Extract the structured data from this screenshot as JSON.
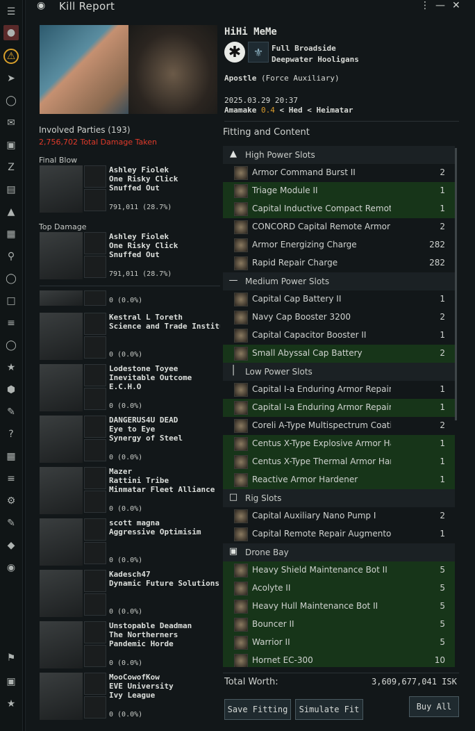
{
  "window": {
    "title": "Kill Report"
  },
  "sidebar": {
    "icons": [
      "menu-icon",
      "character-portrait-icon",
      "alert-icon",
      "ship-icon",
      "inventory-icon",
      "mail-icon",
      "cube-icon",
      "z-icon",
      "chart-icon",
      "map-icon",
      "fitting-icon",
      "search-icon",
      "people-icon",
      "chat-icon",
      "layers-icon",
      "globe-icon",
      "star-icon",
      "shield-icon",
      "wrench-icon",
      "help-icon",
      "list-icon",
      "list2-icon",
      "settings-icon",
      "edit-icon",
      "diamond-icon",
      "kill-icon",
      "flag-icon",
      "save-icon",
      "star-bottom-icon"
    ]
  },
  "victim": {
    "name": "HiHi MeMe",
    "corp": "Full Broadside",
    "alliance": "Deepwater Hooligans",
    "ship": "Apostle",
    "ship_class": "(Force Auxiliary)",
    "time": "2025.03.29 20:37",
    "system": "Amamake",
    "security": "0.4",
    "region_chain": "< Hed < Heimatar"
  },
  "involved": {
    "title": "Involved Parties (193)",
    "damage": "2,756,702 Total Damage Taken",
    "final_blow_label": "Final Blow",
    "top_damage_label": "Top Damage",
    "final_blow": {
      "name": "Ashley Fiolek\nOne Risky Click\nSnuffed Out",
      "dmg": "791,011 (28.7%)"
    },
    "top_damage": {
      "name": "Ashley Fiolek\nOne Risky Click\nSnuffed Out",
      "dmg": "791,011 (28.7%)"
    },
    "list": [
      {
        "name": "",
        "dmg": "0 (0.0%)"
      },
      {
        "name": "Kestral L Toreth\nScience and Trade Institute",
        "dmg": "0 (0.0%)"
      },
      {
        "name": "Lodestone Toyee\nInevitable Outcome\nE.C.H.O",
        "dmg": "0 (0.0%)"
      },
      {
        "name": "DANGERUS4U DEAD\nEye to Eye\nSynergy of Steel",
        "dmg": "0 (0.0%)"
      },
      {
        "name": "Mazer\nRattini Tribe\nMinmatar Fleet Alliance",
        "dmg": "0 (0.0%)"
      },
      {
        "name": "scott magna\nAggressive Optimisim",
        "dmg": "0 (0.0%)"
      },
      {
        "name": "Kadesch47\nDynamic Future Solutions",
        "dmg": "0 (0.0%)"
      },
      {
        "name": "Unstopable Deadman\nThe Northerners\nPandemic Horde",
        "dmg": "0 (0.0%)"
      },
      {
        "name": "MooCowofKow\nEVE University\nIvy League",
        "dmg": "0 (0.0%)"
      }
    ]
  },
  "fitting": {
    "title": "Fitting and Content",
    "rows": [
      {
        "type": "section",
        "label": "High Power Slots",
        "icon": "high-slot-icon"
      },
      {
        "type": "mod",
        "label": "Armor Command Burst II",
        "qty": "2",
        "hl": false
      },
      {
        "type": "mod",
        "label": "Triage Module II",
        "qty": "1",
        "hl": true
      },
      {
        "type": "mod",
        "label": "Capital Inductive Compact Remote",
        "qty": "1",
        "hl": true
      },
      {
        "type": "mod",
        "label": "CONCORD Capital Remote Armor Re",
        "qty": "2",
        "hl": false
      },
      {
        "type": "mod",
        "label": "Armor Energizing Charge",
        "qty": "282",
        "hl": false
      },
      {
        "type": "mod",
        "label": "Rapid Repair Charge",
        "qty": "282",
        "hl": false
      },
      {
        "type": "section",
        "label": "Medium Power Slots",
        "icon": "medium-slot-icon"
      },
      {
        "type": "mod",
        "label": "Capital Cap Battery II",
        "qty": "1",
        "hl": false
      },
      {
        "type": "mod",
        "label": "Navy Cap Booster 3200",
        "qty": "2",
        "hl": false
      },
      {
        "type": "mod",
        "label": "Capital Capacitor Booster II",
        "qty": "1",
        "hl": false
      },
      {
        "type": "mod",
        "label": "Small Abyssal Cap Battery",
        "qty": "2",
        "hl": true
      },
      {
        "type": "section",
        "label": "Low Power Slots",
        "icon": "low-slot-icon"
      },
      {
        "type": "mod",
        "label": "Capital I-a Enduring Armor Repain",
        "qty": "1",
        "hl": false
      },
      {
        "type": "mod",
        "label": "Capital I-a Enduring Armor Repain",
        "qty": "1",
        "hl": true
      },
      {
        "type": "mod",
        "label": "Coreli A-Type Multispectrum Coatin",
        "qty": "2",
        "hl": false
      },
      {
        "type": "mod",
        "label": "Centus X-Type Explosive Armor Ha",
        "qty": "1",
        "hl": true
      },
      {
        "type": "mod",
        "label": "Centus X-Type Thermal Armor Har",
        "qty": "1",
        "hl": true
      },
      {
        "type": "mod",
        "label": "Reactive Armor Hardener",
        "qty": "1",
        "hl": true
      },
      {
        "type": "section",
        "label": "Rig Slots",
        "icon": "rig-slot-icon"
      },
      {
        "type": "mod",
        "label": "Capital Auxiliary Nano Pump I",
        "qty": "2",
        "hl": false
      },
      {
        "type": "mod",
        "label": "Capital Remote Repair Augmentor",
        "qty": "1",
        "hl": false
      },
      {
        "type": "section",
        "label": "Drone Bay",
        "icon": "drone-bay-icon"
      },
      {
        "type": "mod",
        "label": "Heavy Shield Maintenance Bot II",
        "qty": "5",
        "hl": true
      },
      {
        "type": "mod",
        "label": "Acolyte II",
        "qty": "5",
        "hl": true
      },
      {
        "type": "mod",
        "label": "Heavy Hull Maintenance Bot II",
        "qty": "5",
        "hl": true
      },
      {
        "type": "mod",
        "label": "Bouncer II",
        "qty": "5",
        "hl": true
      },
      {
        "type": "mod",
        "label": "Warrior II",
        "qty": "5",
        "hl": true
      },
      {
        "type": "mod",
        "label": "Hornet EC-300",
        "qty": "10",
        "hl": true
      }
    ]
  },
  "footer": {
    "total_label": "Total Worth:",
    "total_value": "3,609,677,041 ISK",
    "save_fitting": "Save Fitting",
    "simulate_fit": "Simulate Fit",
    "buy_all": "Buy All"
  },
  "colors": {
    "highlight": "#173519",
    "damage": "#e03a2a",
    "security": "#d99a2b"
  }
}
